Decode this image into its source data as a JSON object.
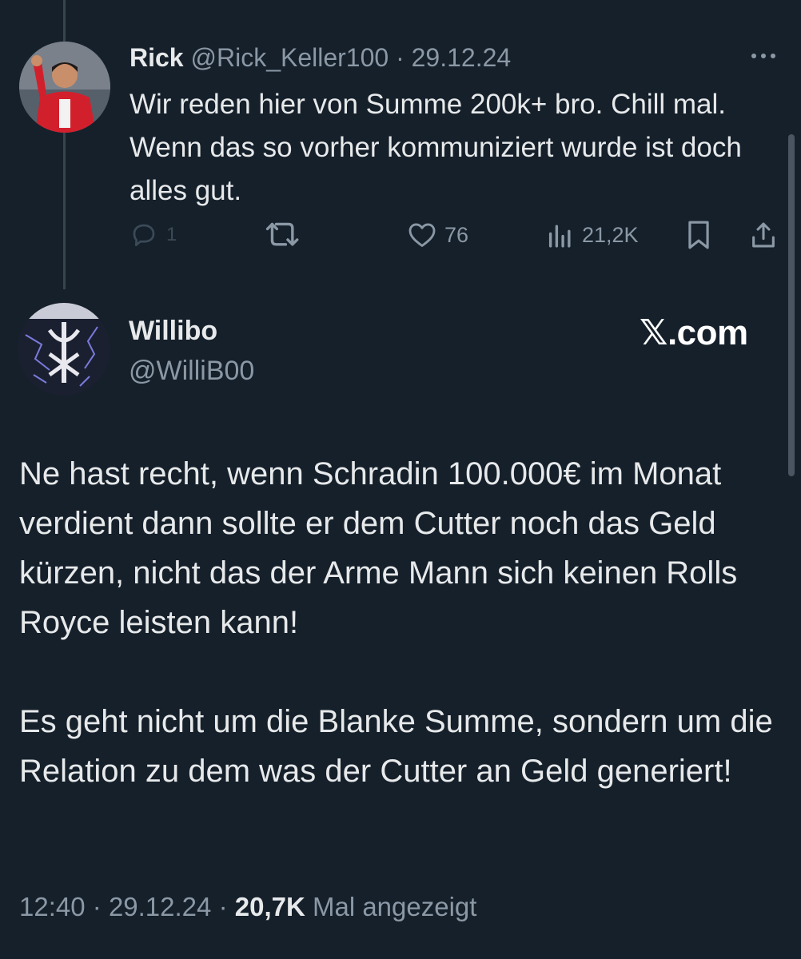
{
  "reply": {
    "name": "Rick",
    "handle": "@Rick_Keller100",
    "separator": "·",
    "date": "29.12.24",
    "text": "Wir reden hier von Summe 200k+ bro. Chill mal. Wenn das so vorher kommuniziert wurde ist doch alles gut.",
    "actions": {
      "reply": {
        "icon": "reply-icon",
        "count": "1"
      },
      "retweet": {
        "icon": "retweet-icon"
      },
      "like": {
        "icon": "heart-icon",
        "count": "76"
      },
      "views": {
        "icon": "views-icon",
        "count": "21,2K"
      },
      "bookmark": {
        "icon": "bookmark-icon"
      },
      "share": {
        "icon": "share-icon"
      }
    }
  },
  "post": {
    "name": "Willibo",
    "handle": "@WilliB00",
    "watermark": "𝕏.com",
    "paragraphs": [
      "Ne hast recht, wenn Schradin 100.000€ im Monat verdient dann sollte er dem Cutter noch das Geld kürzen, nicht das der Arme Mann sich keinen Rolls Royce leisten kann!",
      "Es geht nicht um die Blanke Summe, sondern um die Relation zu dem was der Cutter an Geld generiert!"
    ],
    "time": "12:40",
    "separator": "·",
    "date": "29.12.24",
    "views_count": "20,7K",
    "views_label": "Mal angezeigt"
  },
  "colors": {
    "background": "#15202b",
    "text": "#e7e9ea",
    "secondary": "#8b98a5"
  }
}
